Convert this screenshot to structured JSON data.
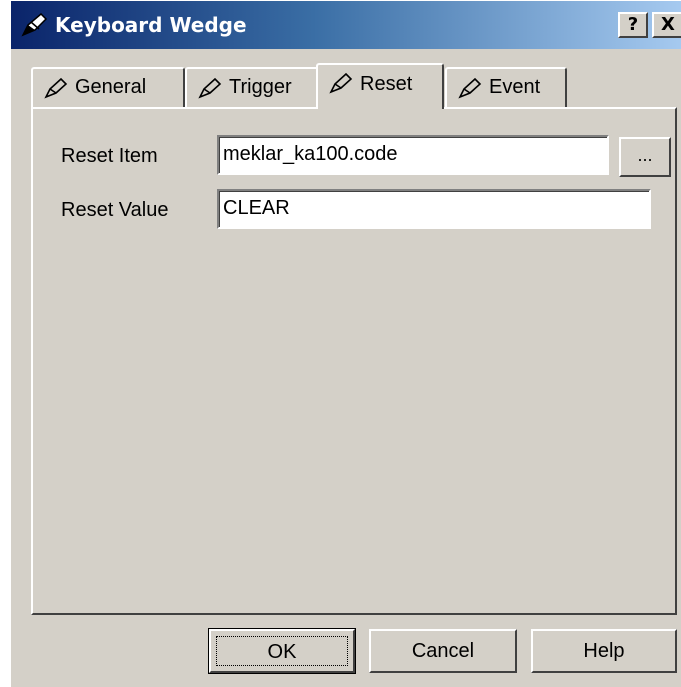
{
  "window": {
    "title": "Keyboard Wedge",
    "help_button": "?",
    "close_button": "X",
    "icon": "pen-icon"
  },
  "tabs": [
    {
      "label": "General",
      "icon": "pen-icon",
      "active": false
    },
    {
      "label": "Trigger",
      "icon": "pen-icon",
      "active": false
    },
    {
      "label": "Reset",
      "icon": "pen-icon",
      "active": true
    },
    {
      "label": "Event",
      "icon": "pen-icon",
      "active": false
    }
  ],
  "form": {
    "reset_item_label": "Reset Item",
    "reset_item_value": "meklar_ka100.code",
    "browse_label": "...",
    "reset_value_label": "Reset Value",
    "reset_value_value": "CLEAR"
  },
  "buttons": {
    "ok": "OK",
    "cancel": "Cancel",
    "help": "Help"
  }
}
